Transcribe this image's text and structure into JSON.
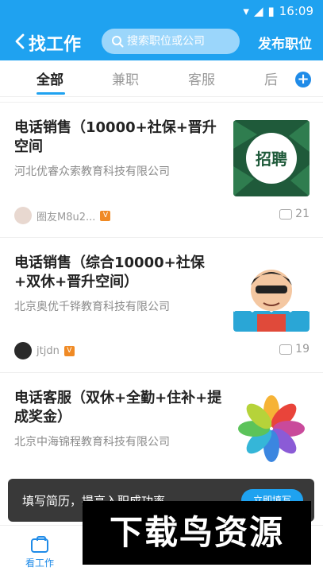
{
  "status": {
    "time": "16:09"
  },
  "header": {
    "title": "找工作",
    "search_placeholder": "搜索职位或公司",
    "publish_label": "发布职位"
  },
  "tabs": [
    {
      "label": "全部",
      "active": true
    },
    {
      "label": "兼职",
      "active": false
    },
    {
      "label": "客服",
      "active": false
    },
    {
      "label": "后",
      "active": false
    }
  ],
  "jobs": [
    {
      "title": "电话销售（10000+社保+晋升空间",
      "company": "河北优睿众索教育科技有限公司",
      "author": "圈友M8u2...",
      "comments": "21",
      "thumb_text": "招聘"
    },
    {
      "title": "电话销售（综合10000+社保+双休+晋升空间）",
      "company": "北京奥优千铧教育科技有限公司",
      "author": "jtjdn",
      "comments": "19",
      "thumb_text": ""
    },
    {
      "title": "电话客服（双休+全勤+住补+提成奖金）",
      "company": "北京中海锦程教育科技有限公司",
      "author": "",
      "comments": "",
      "thumb_text": ""
    }
  ],
  "overlay": {
    "text": "填写简历，提高入职成功率",
    "button": "立即填写"
  },
  "bottom_nav": {
    "label": "看工作"
  },
  "watermark": "下载鸟资源",
  "colors": {
    "primary": "#1fa2f0",
    "accent": "#f08a24"
  }
}
